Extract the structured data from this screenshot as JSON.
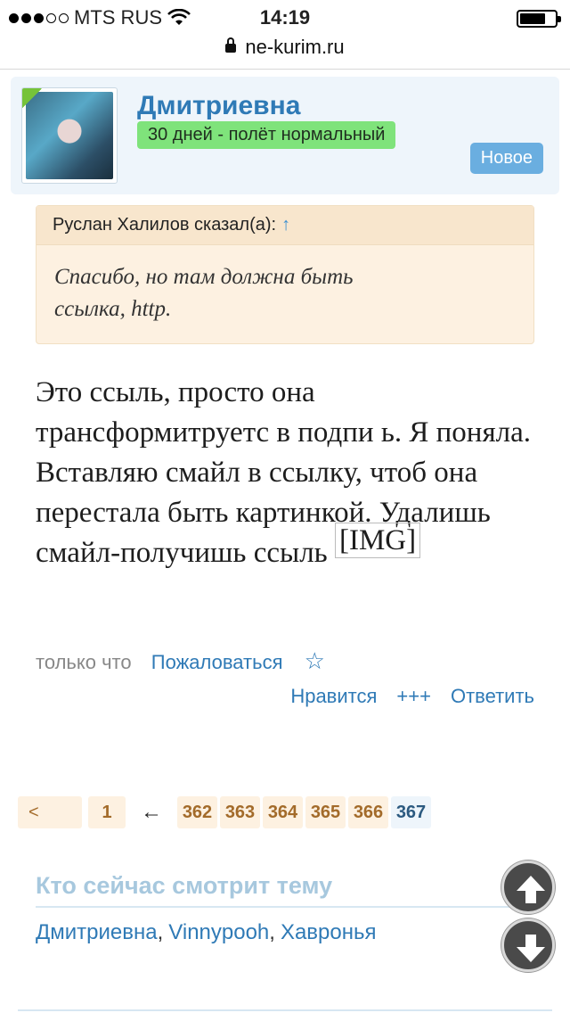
{
  "status_bar": {
    "carrier": "MTS RUS",
    "time": "14:19"
  },
  "browser": {
    "url": "ne-kurim.ru"
  },
  "user_card": {
    "username": "Дмитриевна",
    "status": "30 дней - полёт нормальный",
    "badge": "Новое"
  },
  "quote": {
    "author": "Руслан Халилов сказал(а):",
    "arrow": "↑",
    "text_line1": "Спасибо, но там должна быть",
    "text_line2": "ссылка, http."
  },
  "message": {
    "text": "Это ссыль, просто она трансформитруетс в подпи ь. Я поняла. Вставляю смайл в ссылку, чтоб она перестала быть картинкой. Удалишь смайл-получишь ссыль",
    "img_tag": "[IMG]"
  },
  "meta": {
    "time": "только что",
    "report": "Пожаловаться",
    "star": "☆"
  },
  "actions": {
    "like": "Нравится",
    "plus": "+++",
    "reply": "Ответить"
  },
  "pagination": {
    "prev": "<",
    "first": "1",
    "arrow": "←",
    "pages": [
      "362",
      "363",
      "364",
      "365",
      "366"
    ],
    "current": "367"
  },
  "watching": {
    "title": "Кто сейчас смотрит тему",
    "users": [
      "Дмитриевна",
      "Vinnypooh",
      "Хавронья"
    ]
  }
}
